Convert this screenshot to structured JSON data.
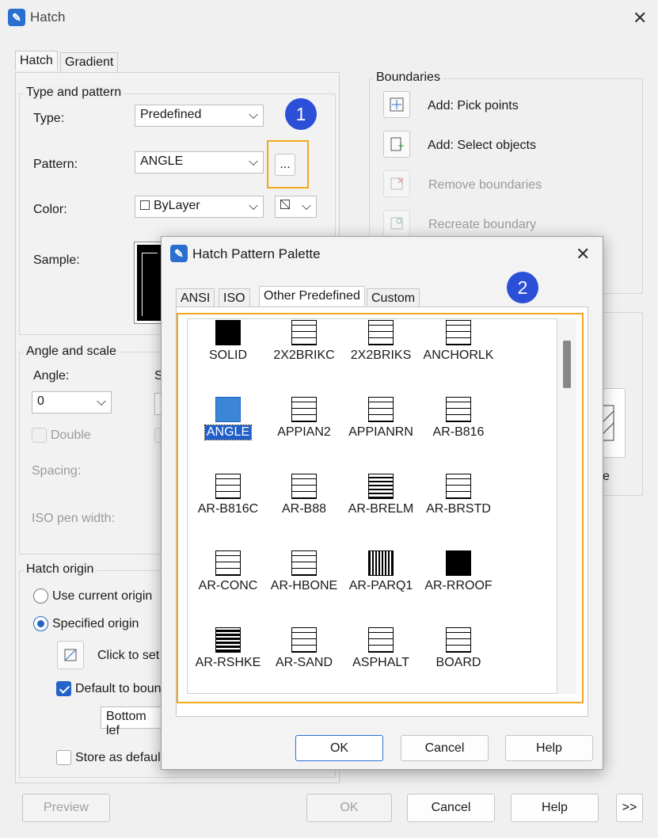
{
  "window": {
    "title": "Hatch",
    "close_glyph": "✕"
  },
  "tabs": [
    {
      "label": "Hatch"
    },
    {
      "label": "Gradient"
    }
  ],
  "type_pattern": {
    "title": "Type and pattern",
    "type_label": "Type:",
    "type_value": "Predefined",
    "pattern_label": "Pattern:",
    "pattern_value": "ANGLE",
    "browse_label": "...",
    "color_label": "Color:",
    "color_value": "ByLayer",
    "sample_label": "Sample:"
  },
  "angle_scale": {
    "title": "Angle and scale",
    "angle_label": "Angle:",
    "angle_value": "0",
    "scale_label_initial": "S",
    "double_label": "Double",
    "spacing_label": "Spacing:",
    "iso_pen_label": "ISO pen width:"
  },
  "hatch_origin": {
    "title": "Hatch origin",
    "use_current": "Use current origin",
    "specified": "Specified origin",
    "click_to_set": "Click to set",
    "default_to_boundary": "Default to boun",
    "position_value": "Bottom lef",
    "store_as_default": "Store as defaul"
  },
  "boundaries": {
    "title": "Boundaries",
    "items": [
      {
        "label": "Add: Pick points",
        "enabled": true,
        "icon": "pick-points-icon"
      },
      {
        "label": "Add: Select objects",
        "enabled": true,
        "icon": "select-objects-icon"
      },
      {
        "label": "Remove boundaries",
        "enabled": false,
        "icon": "remove-boundaries-icon"
      },
      {
        "label": "Recreate boundary",
        "enabled": false,
        "icon": "recreate-boundary-icon"
      }
    ],
    "partial_label": "e"
  },
  "footer": {
    "preview": "Preview",
    "ok": "OK",
    "cancel": "Cancel",
    "help": "Help",
    "more": ">>"
  },
  "badges": {
    "one": "1",
    "two": "2"
  },
  "palette": {
    "title": "Hatch Pattern Palette",
    "close_glyph": "✕",
    "tabs": [
      {
        "label": "ANSI"
      },
      {
        "label": "ISO"
      },
      {
        "label": "Other Predefined"
      },
      {
        "label": "Custom"
      }
    ],
    "patterns": [
      {
        "name": "SOLID"
      },
      {
        "name": "2X2BRIKC"
      },
      {
        "name": "2X2BRIKS"
      },
      {
        "name": "ANCHORLK"
      },
      {
        "name": "ANGLE"
      },
      {
        "name": "APPIAN2"
      },
      {
        "name": "APPIANRN"
      },
      {
        "name": "AR-B816"
      },
      {
        "name": "AR-B816C"
      },
      {
        "name": "AR-B88"
      },
      {
        "name": "AR-BRELM"
      },
      {
        "name": "AR-BRSTD"
      },
      {
        "name": "AR-CONC"
      },
      {
        "name": "AR-HBONE"
      },
      {
        "name": "AR-PARQ1"
      },
      {
        "name": "AR-RROOF"
      },
      {
        "name": "AR-RSHKE"
      },
      {
        "name": "AR-SAND"
      },
      {
        "name": "ASPHALT"
      },
      {
        "name": "BOARD"
      }
    ],
    "selected": "ANGLE",
    "ok": "OK",
    "cancel": "Cancel",
    "help": "Help"
  }
}
